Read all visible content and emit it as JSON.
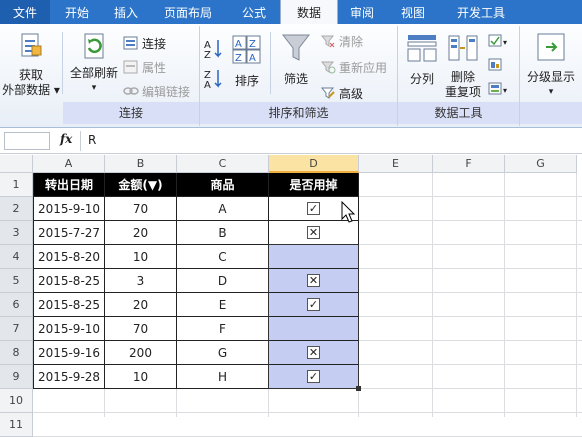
{
  "tabs": [
    "文件",
    "开始",
    "插入",
    "页面布局",
    "公式",
    "数据",
    "审阅",
    "视图",
    "开发工具"
  ],
  "ribbon": {
    "get_external": [
      "获取",
      "外部数据"
    ],
    "refresh_all": "全部刷新",
    "connections": "连接",
    "properties": "属性",
    "edit_links": "编辑链接",
    "group_connections": "连接",
    "sort": "排序",
    "filter": "筛选",
    "clear": "清除",
    "reapply": "重新应用",
    "advanced": "高级",
    "group_sort_filter": "排序和筛选",
    "text_to_columns": "分列",
    "remove_dup": [
      "删除",
      "重复项"
    ],
    "group_data_tools": "数据工具",
    "outline": "分级显示"
  },
  "formula_bar": {
    "fx": "fx",
    "value": "R"
  },
  "columns": [
    "A",
    "B",
    "C",
    "D",
    "E",
    "F",
    "G"
  ],
  "rows": [
    "1",
    "2",
    "3",
    "4",
    "5",
    "6",
    "7",
    "8",
    "9",
    "10",
    "11"
  ],
  "table": {
    "headers": [
      "转出日期",
      "金额(▼)",
      "商品",
      "是否用掉"
    ],
    "records": [
      {
        "date": "2015-9-10",
        "amount": "70",
        "item": "A",
        "check": "check"
      },
      {
        "date": "2015-7-27",
        "amount": "20",
        "item": "B",
        "check": "cross"
      },
      {
        "date": "2015-8-20",
        "amount": "10",
        "item": "C",
        "check": ""
      },
      {
        "date": "2015-8-25",
        "amount": "3",
        "item": "D",
        "check": "cross"
      },
      {
        "date": "2015-8-25",
        "amount": "20",
        "item": "E",
        "check": "check"
      },
      {
        "date": "2015-9-10",
        "amount": "70",
        "item": "F",
        "check": ""
      },
      {
        "date": "2015-9-16",
        "amount": "200",
        "item": "G",
        "check": "cross"
      },
      {
        "date": "2015-9-28",
        "amount": "10",
        "item": "H",
        "check": "check"
      }
    ]
  },
  "colors": {
    "ribbon_tab_bar": "#2b74c9",
    "selection": "#c6cdf2",
    "header_fill": "#000000",
    "selected_col_head": "#fbe3a4"
  },
  "glyphs": {
    "check": "✓",
    "cross": "✕"
  }
}
